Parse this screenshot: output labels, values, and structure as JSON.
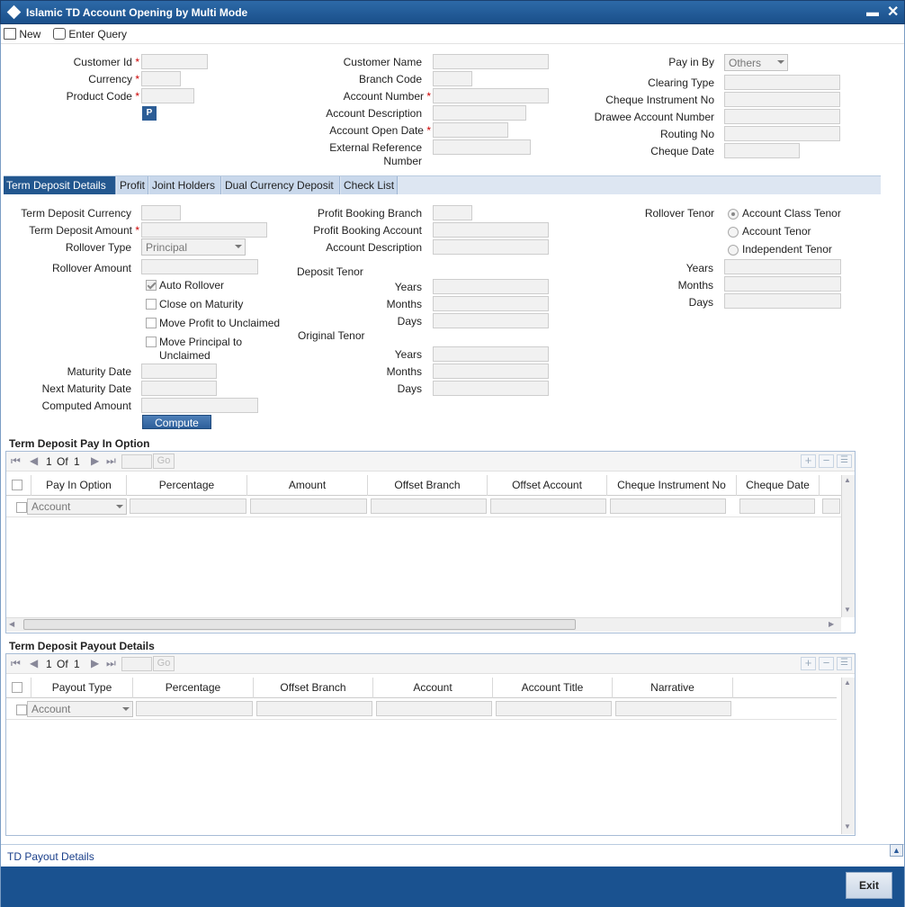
{
  "window": {
    "title": "Islamic TD Account Opening by Multi Mode"
  },
  "toolbar": {
    "new_label": "New",
    "enter_query_label": "Enter Query"
  },
  "header": {
    "customer_id_label": "Customer Id",
    "currency_label": "Currency",
    "product_code_label": "Product Code",
    "p_button": "P",
    "customer_name_label": "Customer Name",
    "branch_code_label": "Branch Code",
    "account_number_label": "Account Number",
    "account_description_label": "Account Description",
    "account_open_date_label": "Account Open Date",
    "external_reference_label_1": "External Reference",
    "external_reference_label_2": "Number",
    "pay_in_by_label": "Pay in By",
    "pay_in_by_value": "Others",
    "clearing_type_label": "Clearing Type",
    "cheque_instrument_no_label": "Cheque Instrument No",
    "drawee_account_number_label": "Drawee Account Number",
    "routing_no_label": "Routing No",
    "cheque_date_label": "Cheque Date",
    "required_mark": "*"
  },
  "tabs": [
    "Term Deposit Details",
    "Profit",
    "Joint Holders",
    "Dual Currency Deposit",
    "Check List"
  ],
  "details": {
    "td_currency_label": "Term Deposit Currency",
    "td_amount_label": "Term Deposit Amount",
    "rollover_type_label": "Rollover Type",
    "rollover_type_value": "Principal",
    "rollover_amount_label": "Rollover Amount",
    "auto_rollover_label": "Auto Rollover",
    "close_on_maturity_label": "Close on Maturity",
    "move_profit_label": "Move Profit to Unclaimed",
    "move_principal_label_1": "Move Principal to",
    "move_principal_label_2": "Unclaimed",
    "maturity_date_label": "Maturity Date",
    "next_maturity_date_label": "Next Maturity Date",
    "computed_amount_label": "Computed Amount",
    "compute_button": "Compute",
    "profit_booking_branch_label": "Profit Booking Branch",
    "profit_booking_account_label": "Profit Booking Account",
    "account_description_label": "Account Description",
    "deposit_tenor_label": "Deposit Tenor",
    "original_tenor_label": "Original Tenor",
    "years_label": "Years",
    "months_label": "Months",
    "days_label": "Days",
    "rollover_tenor_label": "Rollover Tenor",
    "account_class_tenor_label": "Account Class Tenor",
    "account_tenor_label": "Account Tenor",
    "independent_tenor_label": "Independent Tenor"
  },
  "pay_in": {
    "title": "Term Deposit Pay In Option",
    "page_current": "1",
    "page_of": "Of",
    "page_total": "1",
    "go_label": "Go",
    "columns": [
      "Pay In Option",
      "Percentage",
      "Amount",
      "Offset Branch",
      "Offset Account",
      "Cheque Instrument No",
      "Cheque Date"
    ],
    "row_option": "Account"
  },
  "payout": {
    "title": "Term Deposit Payout Details",
    "page_current": "1",
    "page_of": "Of",
    "page_total": "1",
    "go_label": "Go",
    "columns": [
      "Payout Type",
      "Percentage",
      "Offset Branch",
      "Account",
      "Account Title",
      "Narrative"
    ],
    "row_type": "Account"
  },
  "td_payout_details_link": "TD Payout Details",
  "exit_button": "Exit",
  "icons": [
    "diamond-icon",
    "minimize-icon",
    "close-icon",
    "new-icon",
    "enter-query-icon",
    "first-page-icon",
    "prev-page-icon",
    "next-page-icon",
    "last-page-icon",
    "add-row-icon",
    "delete-row-icon",
    "single-view-icon",
    "scroll-up-icon"
  ]
}
